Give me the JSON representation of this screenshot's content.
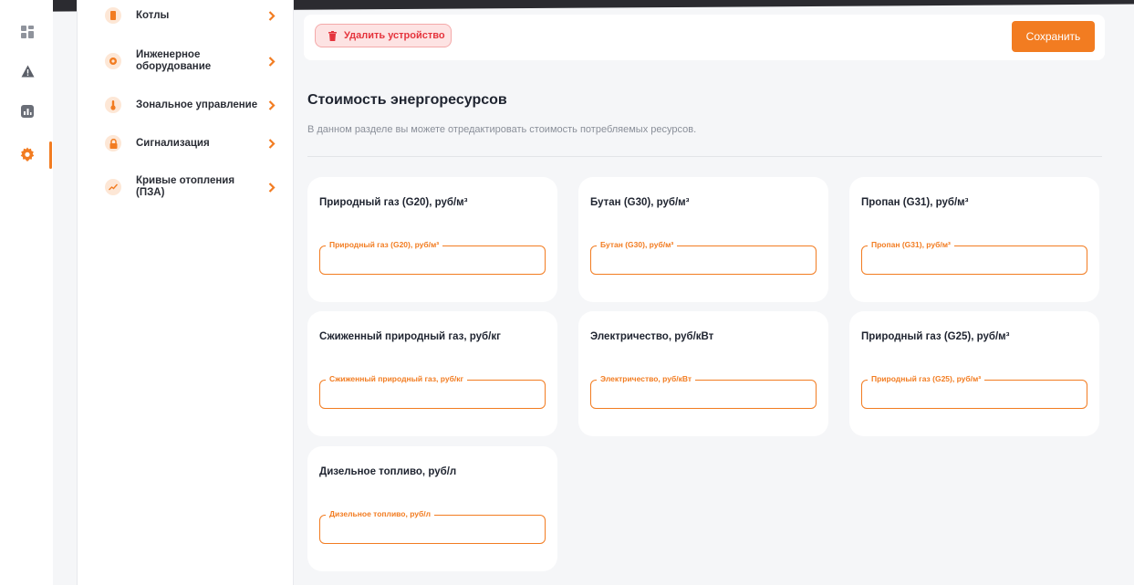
{
  "colors": {
    "accent": "#f27c21",
    "danger": "#e5343d",
    "danger_bg": "#fde3e3"
  },
  "rail": {
    "items": [
      {
        "icon": "dashboard-grid-icon",
        "active": false
      },
      {
        "icon": "warning-icon",
        "active": false
      },
      {
        "icon": "bar-chart-icon",
        "active": false
      },
      {
        "icon": "gear-icon",
        "active": true
      }
    ]
  },
  "sidebar": {
    "items": [
      {
        "label": "Котлы",
        "icon": "boiler-icon"
      },
      {
        "label": "Инженерное оборудование",
        "icon": "engineering-icon"
      },
      {
        "label": "Зональное управление",
        "icon": "thermometer-icon"
      },
      {
        "label": "Сигнализация",
        "icon": "lock-icon"
      },
      {
        "label": "Кривые отопления (ПЗА)",
        "icon": "trend-icon"
      }
    ]
  },
  "actions": {
    "delete_label": "Удалить устройство",
    "save_label": "Сохранить"
  },
  "section": {
    "title": "Стоимость энергоресурсов",
    "description": "В данном разделе вы можете отредактировать стоимость потребляемых ресурсов."
  },
  "cards": [
    {
      "title": "Природный газ (G20), руб/м³",
      "field_label": "Природный газ (G20), руб/м³",
      "value": ""
    },
    {
      "title": "Бутан (G30), руб/м³",
      "field_label": "Бутан (G30), руб/м³",
      "value": ""
    },
    {
      "title": "Пропан (G31), руб/м³",
      "field_label": "Пропан (G31), руб/м³",
      "value": ""
    },
    {
      "title": "Сжиженный природный газ, руб/кг",
      "field_label": "Сжиженный природный газ, руб/кг",
      "value": ""
    },
    {
      "title": "Электричество, руб/кВт",
      "field_label": "Электричество, руб/кВт",
      "value": ""
    },
    {
      "title": "Природный газ (G25), руб/м³",
      "field_label": "Природный газ (G25), руб/м³",
      "value": ""
    },
    {
      "title": "Дизельное топливо, руб/л",
      "field_label": "Дизельное топливо, руб/л",
      "value": ""
    }
  ]
}
